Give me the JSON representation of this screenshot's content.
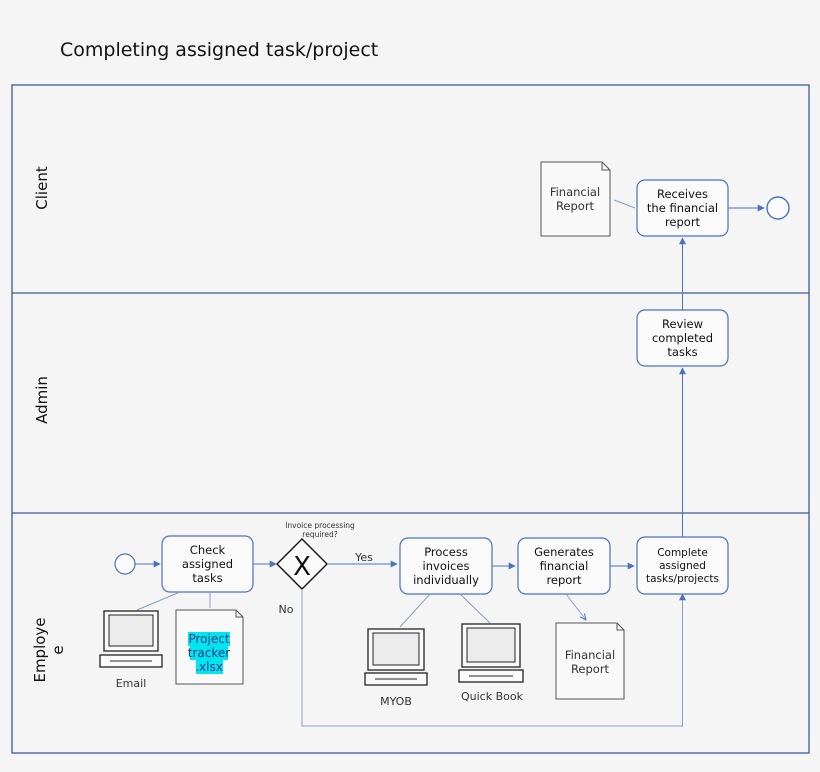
{
  "title": "Completing assigned task/project",
  "lanes": {
    "client": "Client",
    "admin": "Admin",
    "employee": [
      "Employe",
      "e"
    ]
  },
  "nodes": {
    "receives": [
      "Receives",
      "the financial",
      "report"
    ],
    "review": [
      "Review",
      "completed",
      "tasks"
    ],
    "check": [
      "Check",
      "assigned",
      "tasks"
    ],
    "process": [
      "Process",
      "invoices",
      "individually"
    ],
    "generates": [
      "Generates",
      "financial",
      "report"
    ],
    "complete": [
      "Complete",
      "assigned",
      "tasks/projects"
    ]
  },
  "gateway": {
    "symbol": "X",
    "question": [
      "Invoice processing",
      "required?"
    ],
    "yes": "Yes",
    "no": "No"
  },
  "documents": {
    "client_report": [
      "Financial",
      "Report"
    ],
    "employee_report": [
      "Financial",
      "Report"
    ],
    "tracker": [
      "Project",
      "tracker",
      ".xlsx"
    ]
  },
  "computers": {
    "email": "Email",
    "myob": "MYOB",
    "quickbook": "Quick Book"
  },
  "colors": {
    "lane_border": "#3a5a9a",
    "arrow": "#4a72c0",
    "association": "#8aa0c8",
    "highlight": "#00e5f0"
  }
}
